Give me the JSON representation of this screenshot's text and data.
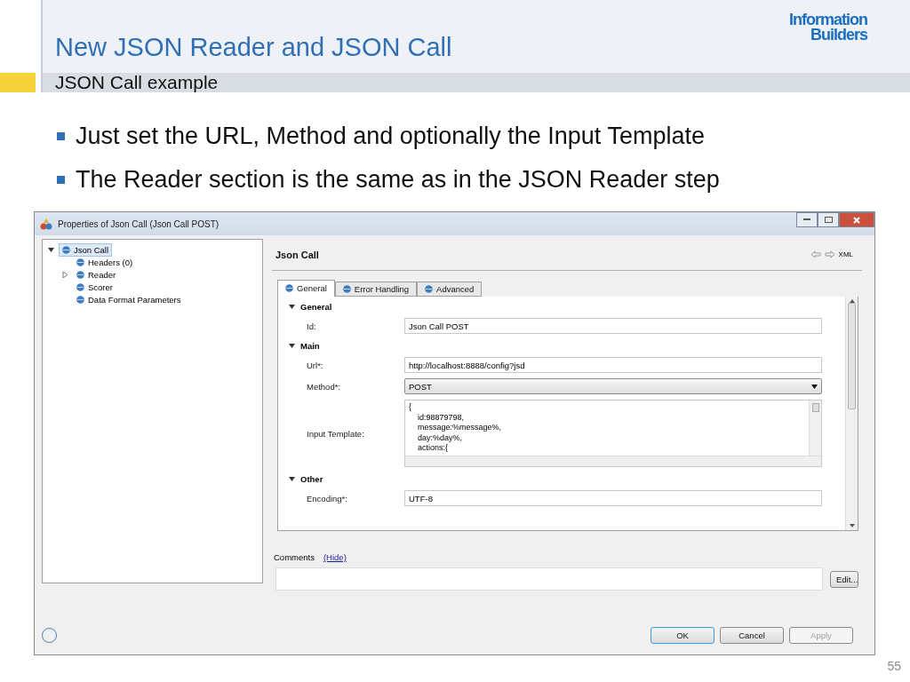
{
  "slide": {
    "title": "New JSON Reader and JSON Call",
    "subtitle": "JSON Call example",
    "logo": [
      "Information",
      "Builders"
    ],
    "bullets": [
      "Just set the URL, Method and optionally the Input Template",
      "The Reader section is the same as in the JSON Reader step"
    ],
    "page_number": "55"
  },
  "dialog": {
    "title": "Properties of Json Call (Json Call POST)",
    "tree": [
      {
        "label": "Json Call",
        "selected": true,
        "expanded": true,
        "children": [
          {
            "label": "Headers (0)",
            "selected": false
          },
          {
            "label": "Reader",
            "selected": false,
            "expanded": false
          },
          {
            "label": "Scorer",
            "selected": false
          },
          {
            "label": "Data Format Parameters",
            "selected": false
          }
        ]
      }
    ],
    "panel_title": "Json Call",
    "xml_label": "XML",
    "tabs": [
      {
        "label": "General",
        "selected": true
      },
      {
        "label": "Error Handling",
        "selected": false
      },
      {
        "label": "Advanced",
        "selected": false
      }
    ],
    "sections": [
      {
        "title": "General",
        "expanded": true,
        "fields": [
          {
            "kind": "text",
            "label": "Id:",
            "value": "Json Call POST"
          }
        ]
      },
      {
        "title": "Main",
        "expanded": true,
        "fields": [
          {
            "kind": "text",
            "label": "Url*:",
            "value": "http://localhost:8888/config?jsd"
          },
          {
            "kind": "select",
            "label": "Method*:",
            "value": "POST"
          },
          {
            "kind": "area",
            "label": "Input Template:",
            "lines": [
              "{",
              "id:98879798,",
              "message:%message%,",
              "day:%day%,",
              "actions:{"
            ]
          }
        ]
      },
      {
        "title": "Other",
        "expanded": true,
        "fields": [
          {
            "kind": "text",
            "label": "Encoding*:",
            "value": "UTF-8"
          }
        ]
      }
    ],
    "comments_label": "Comments",
    "hide_link": "(Hide)",
    "edit_button": "Edit...",
    "buttons": [
      {
        "label": "OK",
        "disabled": false,
        "default": true
      },
      {
        "label": "Cancel",
        "disabled": false,
        "default": false
      },
      {
        "label": "Apply",
        "disabled": true,
        "default": false
      }
    ]
  }
}
